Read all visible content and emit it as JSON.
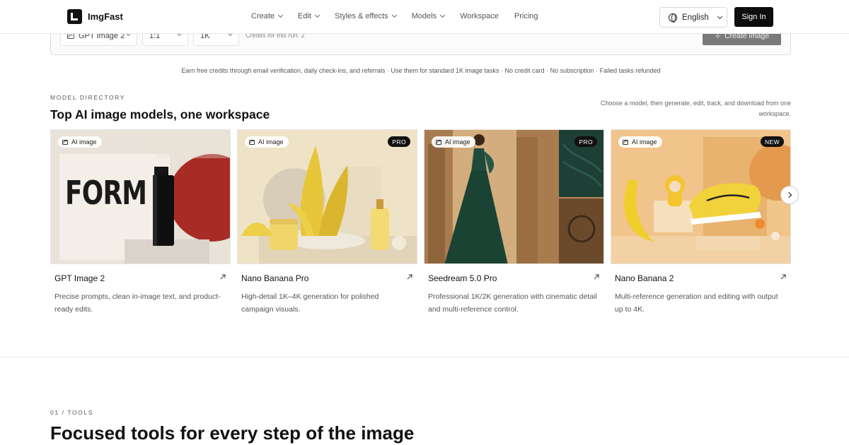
{
  "header": {
    "brand": "ImgFast",
    "nav": [
      {
        "label": "Create",
        "has_dropdown": true
      },
      {
        "label": "Edit",
        "has_dropdown": true
      },
      {
        "label": "Styles & effects",
        "has_dropdown": true
      },
      {
        "label": "Models",
        "has_dropdown": true
      },
      {
        "label": "Workspace",
        "has_dropdown": false
      },
      {
        "label": "Pricing",
        "has_dropdown": false
      }
    ],
    "language": "English",
    "sign_in": "Sign In"
  },
  "generator": {
    "model_select": "GPT Image 2",
    "ratio_select": "1:1",
    "resolution_select": "1K",
    "credits_text": "Credits for this run: 2",
    "create_button": "Create image"
  },
  "earn_line": "Earn free credits through email verification, daily check-ins, and referrals · Use them for standard 1K image tasks · No credit card · No subscription · Failed tasks refunded",
  "directory": {
    "eyebrow": "MODEL DIRECTORY",
    "title": "Top AI image models, one workspace",
    "note": "Choose a model, then generate, edit, track, and download from one workspace.",
    "cards": [
      {
        "tag": "AI image",
        "badge": "",
        "poster_text": "FORM",
        "name": "GPT Image 2",
        "desc": "Precise prompts, clean in-image text, and product-ready edits."
      },
      {
        "tag": "AI image",
        "badge": "PRO",
        "name": "Nano Banana Pro",
        "desc": "High-detail 1K–4K generation for polished campaign visuals."
      },
      {
        "tag": "AI image",
        "badge": "PRO",
        "name": "Seedream 5.0 Pro",
        "desc": "Professional 1K/2K generation with cinematic detail and multi-reference control."
      },
      {
        "tag": "AI image",
        "badge": "NEW",
        "name": "Nano Banana 2",
        "desc": "Multi-reference generation and editing with output up to 4K."
      }
    ]
  },
  "tools": {
    "eyebrow": "01 / TOOLS",
    "title": "Focused tools for every step of the image"
  },
  "icons": [
    "globe-icon",
    "chevron-down-icon",
    "image-icon",
    "sparkle-icon",
    "arrow-up-right-icon",
    "chevron-right-icon"
  ],
  "colors": {
    "primary_button": "#0d0d0d",
    "create_button_disabled": "#7a7a7a",
    "card_border": "#e4e4e4"
  }
}
